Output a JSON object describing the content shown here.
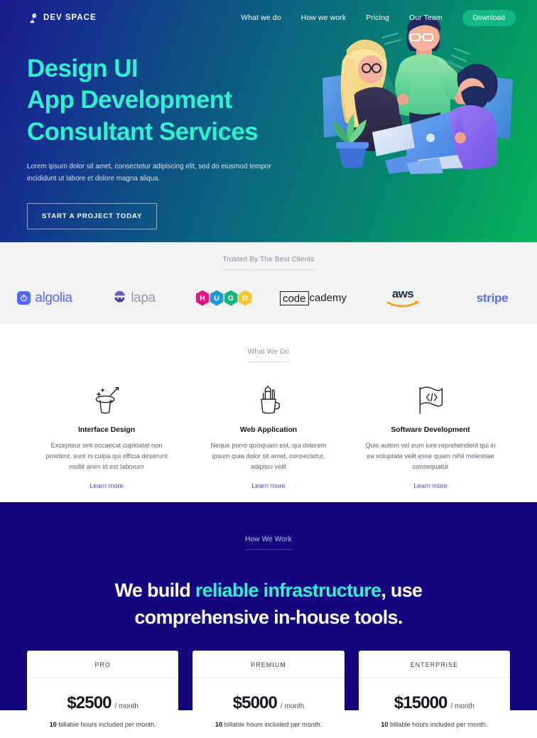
{
  "nav": {
    "logo_text": "DEV SPACE",
    "logo_icon": "rocket-bird-icon",
    "links": [
      {
        "label": "What we do"
      },
      {
        "label": "How we work"
      },
      {
        "label": "Pricing"
      },
      {
        "label": "Our Team"
      }
    ],
    "cta_label": "Download",
    "cta_color": "#12b886"
  },
  "hero": {
    "title_line1": "Design UI",
    "title_line2": "App Development",
    "title_line3": "Consultant Services",
    "title_color": "#2ff0d0",
    "paragraph": "Lorem ipsum dolor sit amet, consectetur adipiscing elit, sed do eiusmod tempor incididunt ut labore et dolore magna aliqua.",
    "button_label": "START A PROJECT TODAY",
    "illustration": "team-collaboration-illustration",
    "gradient_from": "#1a1a8c",
    "gradient_to": "#07b45c"
  },
  "clients": {
    "eyebrow": "Trusted By The Best Clients",
    "logos": [
      {
        "name": "algolia",
        "label": "algolia",
        "color": "#5468ff"
      },
      {
        "name": "lapa",
        "label": "lapa",
        "color": "#9a9aa8"
      },
      {
        "name": "hugo",
        "label": "HUGO",
        "letters": [
          "H",
          "U",
          "G",
          "O"
        ],
        "colors": [
          "#e5157f",
          "#1c9ad6",
          "#16b37f",
          "#f4c82c"
        ]
      },
      {
        "name": "codecademy",
        "label_boxed": "code",
        "label_rest": "cademy",
        "color": "#1f1f1f"
      },
      {
        "name": "aws",
        "label": "aws",
        "color": "#232f3e",
        "accent": "#ff9900"
      },
      {
        "name": "stripe",
        "label": "stripe",
        "color": "#5c6cf2"
      }
    ]
  },
  "what_we_do": {
    "eyebrow": "What We Do",
    "cards": [
      {
        "icon": "magic-hat-wand-icon",
        "title": "Interface Design",
        "text": "Excepteur sint occaecat cupidatat non proident, sunt in culpa qui officia deserunt mollit anim id est laborum",
        "link": "Learn more"
      },
      {
        "icon": "pencil-cup-icon",
        "title": "Web Application",
        "text": "Neque porro quisquam est, qui dolorem ipsum quia dolor sit amet, consectetur, adipisci velit",
        "link": "Learn more"
      },
      {
        "icon": "code-flag-icon",
        "title": "Software Development",
        "text": "Quis autem vel eum iure reprehenderit qui in ea voluptate velit esse quam nihil molestiae consequatur",
        "link": "Learn more"
      }
    ],
    "link_color": "#5a4de0"
  },
  "how_we_work": {
    "eyebrow": "How We Work",
    "heading_part1": "We build ",
    "heading_accent": "reliable infrastructure",
    "heading_part2": ", use",
    "heading_line2": "comprehensive in-house tools.",
    "accent_color": "#2ff0d0",
    "background": "#15067f",
    "plans": [
      {
        "name": "PRO",
        "price": "$2500",
        "period": "/ month",
        "hours": "10",
        "note": " billable hours included per month."
      },
      {
        "name": "PREMIUM",
        "price": "$5000",
        "period": "/ month",
        "hours": "10",
        "note": " billable hours included per month."
      },
      {
        "name": "ENTERPRISE",
        "price": "$15000",
        "period": "/ month",
        "hours": "10",
        "note": " billable hours included per month."
      }
    ]
  }
}
